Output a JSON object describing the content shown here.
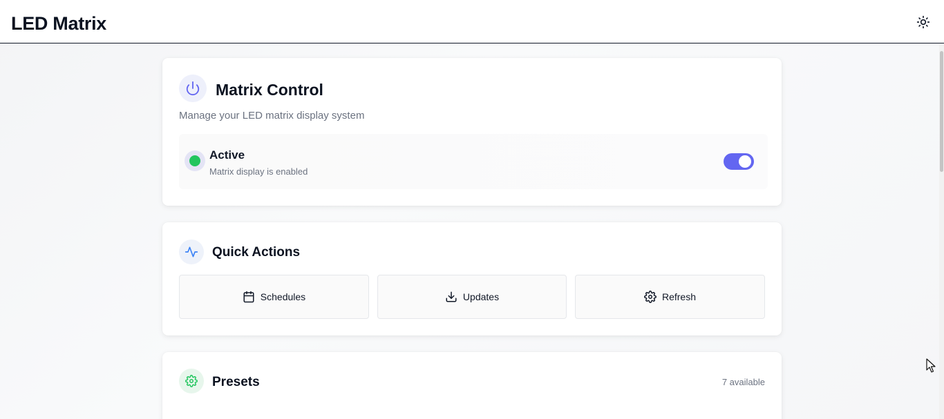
{
  "header": {
    "title": "LED Matrix",
    "theme_icon": "sun-icon"
  },
  "matrix_control": {
    "title": "Matrix Control",
    "description": "Manage your LED matrix display system",
    "icon": "power-icon",
    "status": {
      "title": "Active",
      "subtitle": "Matrix display is enabled",
      "enabled": true
    },
    "accent_color": "#6366f1",
    "status_color": "#22c55e"
  },
  "quick_actions": {
    "title": "Quick Actions",
    "icon": "activity-icon",
    "buttons": [
      {
        "label": "Schedules",
        "icon": "calendar-icon"
      },
      {
        "label": "Updates",
        "icon": "download-icon"
      },
      {
        "label": "Refresh",
        "icon": "gear-icon"
      }
    ]
  },
  "presets": {
    "title": "Presets",
    "icon": "gear-icon",
    "count_label": "7 available",
    "accent_color": "#22c55e"
  }
}
